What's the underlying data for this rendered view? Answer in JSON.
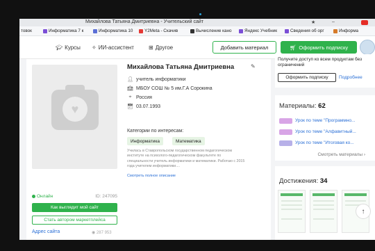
{
  "window": {
    "title": "Михайлова Татьяна Дмитриевна - Учительский сайт"
  },
  "bookmarks": [
    {
      "label": "товок",
      "color": "#ffffff"
    },
    {
      "label": "Информатика 7 к",
      "color": "#7b4fd6"
    },
    {
      "label": "Информатика 10",
      "color": "#5b6fd6"
    },
    {
      "label": "Y2Meta - Скачив",
      "color": "#e53935"
    },
    {
      "label": "Вычисление кано",
      "color": "#333333"
    },
    {
      "label": "Яндекс Учебник",
      "color": "#7b4fd6"
    },
    {
      "label": "Сведения об орг",
      "color": "#7b4fd6"
    },
    {
      "label": "Информа",
      "color": "#d67b2a"
    }
  ],
  "header": {
    "nav": [
      {
        "label": "Курсы",
        "icon": "graduation-cap-icon"
      },
      {
        "label": "ИИ-ассистент",
        "icon": "sparkle-icon"
      },
      {
        "label": "Другое",
        "icon": "grid-icon"
      }
    ],
    "add_material": "Добавить материал",
    "subscribe": "Оформить подписку"
  },
  "profile": {
    "name": "Михайлова Татьяна Дмитриевна",
    "position": "учитель информатики",
    "school": "МБОУ СОШ № 5 им.Г.А Сорокина",
    "country": "Россия",
    "date": "03.07.1993",
    "categories_title": "Категории по интересам:",
    "categories": [
      "Информатика",
      "Математика"
    ],
    "bio": "Училась в Ставропольском государственном педагогическом институте на психолого-педагогическом факультете по специальности учитель информатики и математики. Работаю с 2015 года учителем информатики....",
    "bio_link": "Смотреть полное описание",
    "status": "Онлайн",
    "id_text": "ID: 247095",
    "site_button": "Как выглядит мой сайт",
    "market_button": "Стать автором маркетплейса",
    "site_address": "Адрес сайта",
    "views": "287 953"
  },
  "promo": {
    "text": "Получите доступ ко всем продуктам без ограничений",
    "button": "Оформить подписку",
    "more": "Подробнее"
  },
  "materials": {
    "label": "Материалы:",
    "count": "62",
    "items": [
      {
        "title": "Урок по теме \"Программно..."
      },
      {
        "title": "Урок по теме \"Алфавитный..."
      },
      {
        "title": "Урок по теме \"Итоговая ко..."
      }
    ],
    "see_all": "Смотреть материалы ›"
  },
  "achievements": {
    "label": "Достижения:",
    "count": "34"
  },
  "colors": {
    "accent_green": "#2fb24c",
    "link_blue": "#2a6fd6"
  }
}
